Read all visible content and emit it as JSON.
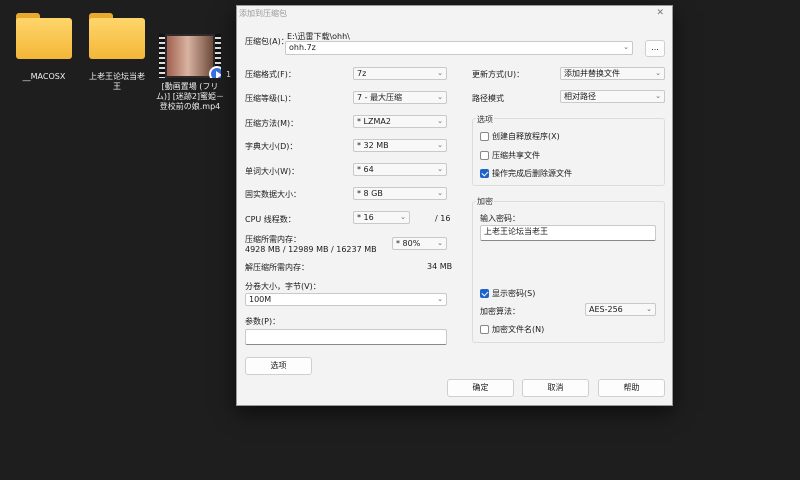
{
  "desktop": {
    "icons": [
      {
        "label": "__MACOSX",
        "type": "folder"
      },
      {
        "label": "上老王论坛当老王",
        "type": "folder"
      },
      {
        "label": "[動画置場 (フリム)] [迷跡2]蜜姫－登校前の娘.mp4",
        "type": "video"
      },
      {
        "label": "1",
        "type": "partial"
      }
    ]
  },
  "dialog": {
    "title": "添加到压缩包",
    "archive_label": "压缩包(A)：",
    "archive_path": "E:\\迅雷下载\\ohh\\",
    "archive_name": "ohh.7z",
    "browse_label": "...",
    "left": {
      "format_label": "压缩格式(F)：",
      "format_value": "7z",
      "level_label": "压缩等级(L)：",
      "level_value": "7 - 最大压缩",
      "method_label": "压缩方法(M)：",
      "method_value": "*  LZMA2",
      "dict_label": "字典大小(D)：",
      "dict_value": "*  32 MB",
      "word_label": "单词大小(W)：",
      "word_value": "*  64",
      "solid_label": "固实数据大小：",
      "solid_value": "*  8 GB",
      "cpu_label": "CPU 线程数：",
      "cpu_value": "*  16",
      "cpu_total": "/ 16",
      "mem_label": "压缩所需内存：",
      "mem_value": "4928 MB / 12989 MB / 16237 MB",
      "mem_percent": "* 80%",
      "decomp_label": "解压缩所需内存：",
      "decomp_value": "34 MB",
      "split_label": "分卷大小，字节(V)：",
      "split_value": "100M",
      "params_label": "参数(P)：",
      "params_value": "",
      "options_button": "选项"
    },
    "right": {
      "update_label": "更新方式(U)：",
      "update_value": "添加并替换文件",
      "path_label": "路径模式",
      "path_value": "相对路径",
      "options_group": "选项",
      "opt_sfx": "创建自释放程序(X)",
      "opt_shared": "压缩共享文件",
      "opt_delete": "操作完成后删除源文件",
      "encrypt_group": "加密",
      "password_label": "输入密码：",
      "password_value": "上老王论坛当老王",
      "show_password": "显示密码(S)",
      "algo_label": "加密算法：",
      "algo_value": "AES-256",
      "encrypt_names": "加密文件名(N)"
    },
    "buttons": {
      "ok": "确定",
      "cancel": "取消",
      "help": "帮助"
    },
    "states": {
      "opt_sfx": false,
      "opt_shared": false,
      "opt_delete": true,
      "show_password": true,
      "encrypt_names": false
    }
  }
}
